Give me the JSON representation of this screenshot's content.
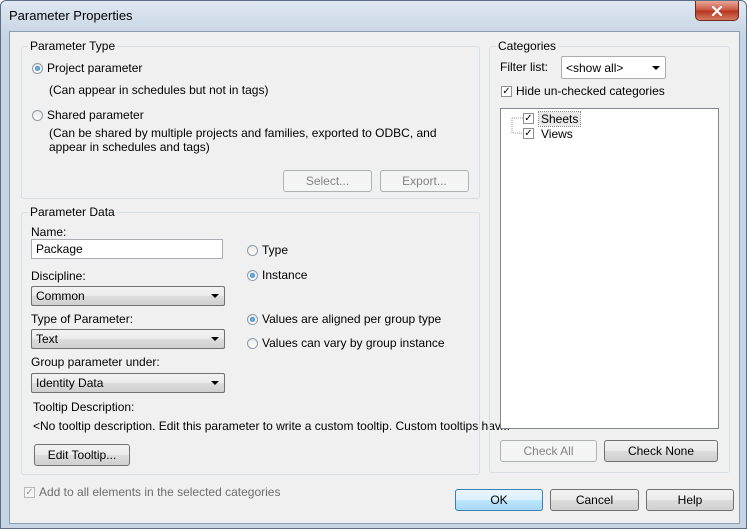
{
  "window": {
    "title": "Parameter Properties"
  },
  "parameter_type": {
    "title": "Parameter Type",
    "project": {
      "label": "Project parameter",
      "description": "(Can appear in schedules but not in tags)",
      "selected": true
    },
    "shared": {
      "label": "Shared parameter",
      "description_line1": "(Can be shared by multiple projects and families, exported to ODBC, and",
      "description_line2": "appear in schedules and tags)",
      "selected": false
    },
    "select_button": "Select...",
    "export_button": "Export..."
  },
  "parameter_data": {
    "title": "Parameter Data",
    "name_label": "Name:",
    "name_value": "Package",
    "discipline_label": "Discipline:",
    "discipline_value": "Common",
    "type_label": "Type of Parameter:",
    "type_value": "Text",
    "group_label": "Group parameter under:",
    "group_value": "Identity Data",
    "tooltip_label": "Tooltip Description:",
    "tooltip_text": "<No tooltip description. Edit this parameter to write a custom tooltip. Custom tooltips hav...",
    "edit_tooltip_button": "Edit Tooltip...",
    "type_radio": "Type",
    "instance_radio": "Instance",
    "aligned_radio": "Values are aligned per group type",
    "vary_radio": "Values can vary by group instance"
  },
  "categories": {
    "title": "Categories",
    "filter_label": "Filter list:",
    "filter_value": "<show all>",
    "hide_unchecked_label": "Hide un-checked categories",
    "items": [
      {
        "label": "Sheets",
        "checked": true
      },
      {
        "label": "Views",
        "checked": true
      }
    ],
    "check_all_button": "Check All",
    "check_none_button": "Check None"
  },
  "footer": {
    "add_to_all_label": "Add to all elements in the selected categories",
    "ok_button": "OK",
    "cancel_button": "Cancel",
    "help_button": "Help"
  }
}
